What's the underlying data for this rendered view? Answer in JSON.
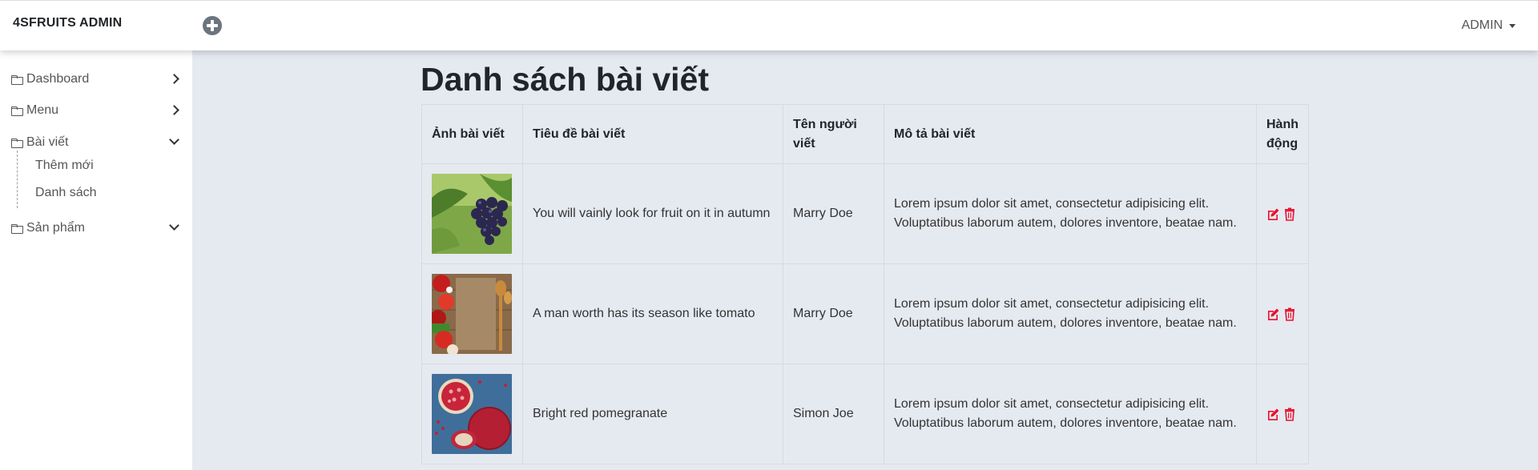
{
  "app": {
    "brand": "4SFRUITS ADMIN",
    "user_menu": "ADMIN"
  },
  "sidebar": {
    "items": [
      {
        "label": "Dashboard"
      },
      {
        "label": "Menu"
      },
      {
        "label": "Bài viết",
        "children": [
          {
            "label": "Thêm mới"
          },
          {
            "label": "Danh sách"
          }
        ]
      },
      {
        "label": "Sản phẩm"
      }
    ]
  },
  "page": {
    "title": "Danh sách bài viết"
  },
  "table": {
    "headers": [
      "Ảnh bài viết",
      "Tiêu đề bài viết",
      "Tên người viết",
      "Mô tả bài viết",
      "Hành động"
    ],
    "rows": [
      {
        "image": "grapes-photo",
        "title": "You will vainly look for fruit on it in autumn",
        "author": "Marry Doe",
        "description": "Lorem ipsum dolor sit amet, consectetur adipisicing elit. Voluptatibus laborum autem, dolores inventore, beatae nam."
      },
      {
        "image": "vegetables-table-photo",
        "title": "A man worth has its season like tomato",
        "author": "Marry Doe",
        "description": "Lorem ipsum dolor sit amet, consectetur adipisicing elit. Voluptatibus laborum autem, dolores inventore, beatae nam."
      },
      {
        "image": "pomegranate-photo",
        "title": "Bright red pomegranate",
        "author": "Simon Joe",
        "description": "Lorem ipsum dolor sit amet, consectetur adipisicing elit. Voluptatibus laborum autem, dolores inventore, beatae nam."
      }
    ]
  },
  "icons": {
    "add": "plus-circle-icon",
    "folder": "folder-icon",
    "edit": "edit-icon",
    "delete": "trash-icon"
  },
  "colors": {
    "action_icon": "#e8112d",
    "content_background": "#e5e9f0",
    "sidebar_background": "#ffffff"
  }
}
